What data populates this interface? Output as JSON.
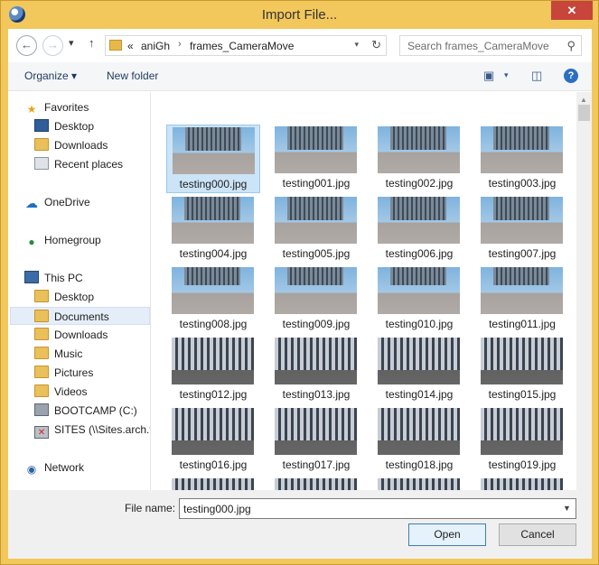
{
  "window": {
    "title": "Import File...",
    "close_label": "✕"
  },
  "address": {
    "overflow": "«",
    "crumbs": [
      "aniGh",
      "frames_CameraMove"
    ]
  },
  "search": {
    "placeholder": "Search frames_CameraMove"
  },
  "toolbar": {
    "organize_label": "Organize ▾",
    "new_folder_label": "New folder"
  },
  "sidebar": {
    "items": [
      {
        "label": "Favorites",
        "icon": "star-icon"
      },
      {
        "label": "Desktop",
        "icon": "desktop-icon"
      },
      {
        "label": "Downloads",
        "icon": "downloads-folder-icon"
      },
      {
        "label": "Recent places",
        "icon": "recent-places-icon"
      },
      {
        "label": "OneDrive",
        "icon": "cloud-icon"
      },
      {
        "label": "Homegroup",
        "icon": "homegroup-icon"
      },
      {
        "label": "This PC",
        "icon": "computer-icon"
      },
      {
        "label": "Desktop",
        "icon": "folder-icon"
      },
      {
        "label": "Documents",
        "icon": "folder-icon"
      },
      {
        "label": "Downloads",
        "icon": "folder-icon"
      },
      {
        "label": "Music",
        "icon": "folder-icon"
      },
      {
        "label": "Pictures",
        "icon": "folder-icon"
      },
      {
        "label": "Videos",
        "icon": "folder-icon"
      },
      {
        "label": "BOOTCAMP (C:)",
        "icon": "drive-icon"
      },
      {
        "label": "SITES (\\\\Sites.arch.vi",
        "icon": "network-drive-icon"
      },
      {
        "label": "Network",
        "icon": "network-icon"
      }
    ],
    "selected": "Documents"
  },
  "files": [
    "testing000.jpg",
    "testing001.jpg",
    "testing002.jpg",
    "testing003.jpg",
    "testing004.jpg",
    "testing005.jpg",
    "testing006.jpg",
    "testing007.jpg",
    "testing008.jpg",
    "testing009.jpg",
    "testing010.jpg",
    "testing011.jpg",
    "testing012.jpg",
    "testing013.jpg",
    "testing014.jpg",
    "testing015.jpg",
    "testing016.jpg",
    "testing017.jpg",
    "testing018.jpg",
    "testing019.jpg",
    "",
    "",
    "",
    ""
  ],
  "selected_file": "testing000.jpg",
  "bottom": {
    "filename_label": "File name:",
    "filename_value": "testing000.jpg",
    "open_label": "Open",
    "cancel_label": "Cancel"
  },
  "colors": {
    "title_bar": "#f2c75c",
    "close_button": "#c7453a",
    "selection": "#cce4f7",
    "accent": "#2c6ec2"
  }
}
